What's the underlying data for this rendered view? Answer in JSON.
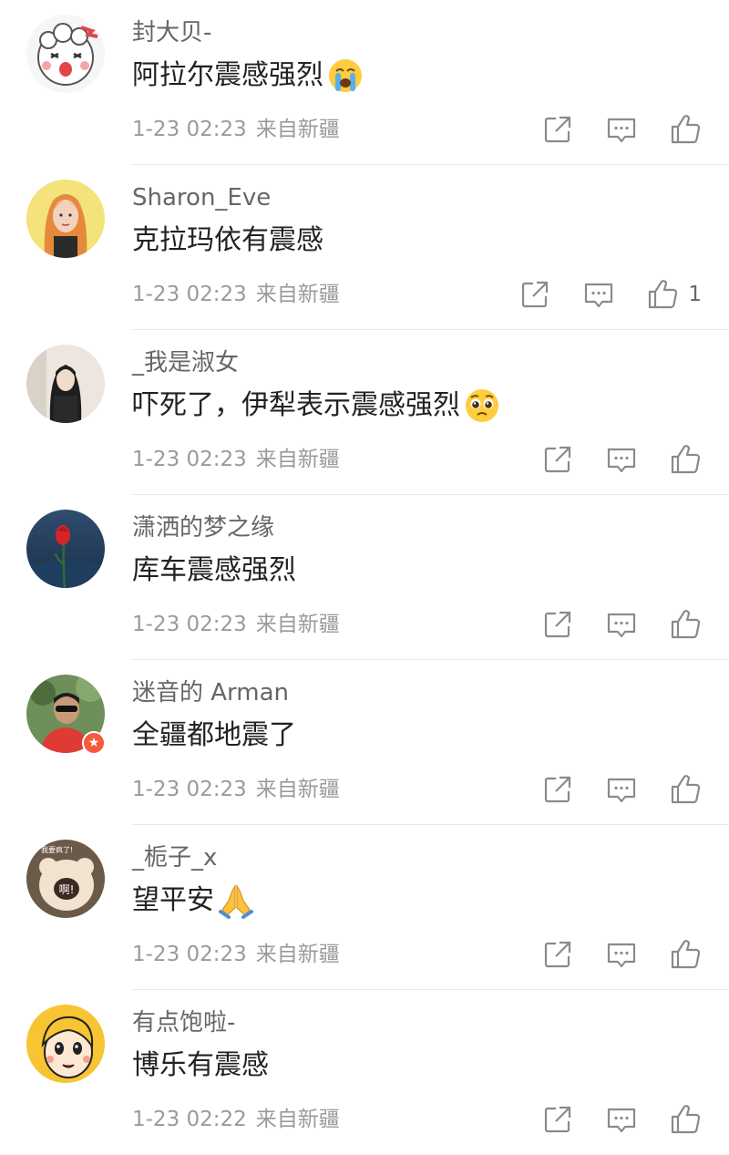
{
  "comments": [
    {
      "username": "封大贝-",
      "text": "阿拉尔震感强烈",
      "emoji": "loudly-crying-face",
      "date": "1-23 02:23",
      "location": "来自新疆",
      "like_count": ""
    },
    {
      "username": "Sharon_Eve",
      "text": "克拉玛依有震感",
      "emoji": "",
      "date": "1-23 02:23",
      "location": "来自新疆",
      "like_count": "1"
    },
    {
      "username": "_我是淑女",
      "text": "吓死了，伊犁表示震感强烈",
      "emoji": "pleading-face",
      "date": "1-23 02:23",
      "location": "来自新疆",
      "like_count": ""
    },
    {
      "username": "潇洒的梦之缘",
      "text": "库车震感强烈",
      "emoji": "",
      "date": "1-23 02:23",
      "location": "来自新疆",
      "like_count": ""
    },
    {
      "username": "迷音的 Arman",
      "text": "全疆都地震了",
      "emoji": "",
      "date": "1-23 02:23",
      "location": "来自新疆",
      "like_count": ""
    },
    {
      "username": "_栀子_x",
      "text": "望平安",
      "emoji": "folded-hands",
      "date": "1-23 02:23",
      "location": "来自新疆",
      "like_count": ""
    },
    {
      "username": "有点饱啦-",
      "text": "博乐有震感",
      "emoji": "",
      "date": "1-23 02:22",
      "location": "来自新疆",
      "like_count": ""
    }
  ],
  "avatar_badges": {
    "c6": "啊!",
    "c6_top": "我要疯了!"
  },
  "icons": {
    "share": "share-icon",
    "comment": "comment-icon",
    "like": "thumbs-up-icon",
    "verified": "verified-badge-icon"
  },
  "colors": {
    "text": "#222222",
    "username": "#666666",
    "meta": "#9a9a9a",
    "icon": "#8a8a8a",
    "badge": "#f55a3a"
  }
}
